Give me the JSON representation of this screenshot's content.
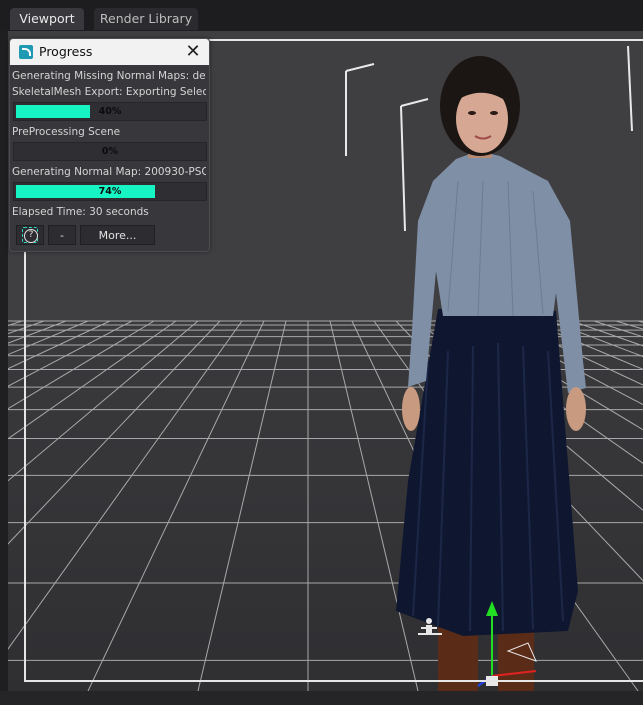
{
  "tabs": [
    {
      "label": "Viewport",
      "active": true
    },
    {
      "label": "Render Library",
      "active": false
    }
  ],
  "progress_dialog": {
    "title": "Progress",
    "icon": "app-logo-icon",
    "close_icon": "close-icon",
    "lines": {
      "missing_normal_maps": "Generating Missing Normal Maps: def...",
      "skeletal_export": "SkeletalMesh Export: Exporting Selecti...",
      "preprocessing": "PreProcessing Scene",
      "normal_map": "Generating Normal Map: 200930-PSO-...",
      "elapsed": "Elapsed Time: 30 seconds"
    },
    "bars": {
      "skeletal_export": {
        "value": 0.4,
        "label": "40%"
      },
      "preprocessing": {
        "value": 0.0,
        "label": "0%"
      },
      "normal_map": {
        "value": 0.74,
        "label": "74%"
      }
    },
    "buttons": {
      "help_icon": "help-icon",
      "help_glyph": "?",
      "minimize": "-",
      "more": "More..."
    },
    "accent_color": "#18f5c4"
  }
}
